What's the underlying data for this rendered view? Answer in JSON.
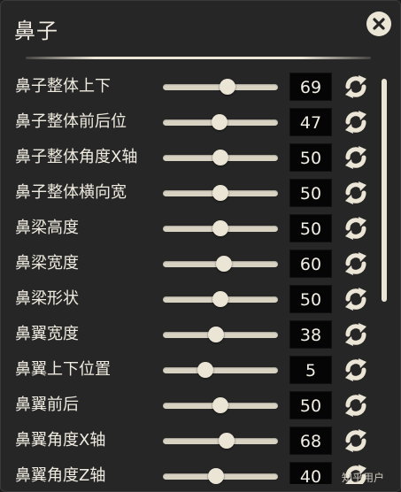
{
  "panel": {
    "title": "鼻子",
    "close_icon": "close-x-circle-icon"
  },
  "sliders": [
    {
      "label": "鼻子整体上下",
      "value": "69",
      "fraction": 0.56
    },
    {
      "label": "鼻子整体前后位",
      "value": "47",
      "fraction": 0.49
    },
    {
      "label": "鼻子整体角度X轴",
      "value": "50",
      "fraction": 0.5
    },
    {
      "label": "鼻子整体横向宽",
      "value": "50",
      "fraction": 0.5
    },
    {
      "label": "鼻梁高度",
      "value": "50",
      "fraction": 0.5
    },
    {
      "label": "鼻梁宽度",
      "value": "60",
      "fraction": 0.53
    },
    {
      "label": "鼻梁形状",
      "value": "50",
      "fraction": 0.5
    },
    {
      "label": "鼻翼宽度",
      "value": "38",
      "fraction": 0.46
    },
    {
      "label": "鼻翼上下位置",
      "value": "5",
      "fraction": 0.37
    },
    {
      "label": "鼻翼前后",
      "value": "50",
      "fraction": 0.5
    },
    {
      "label": "鼻翼角度X轴",
      "value": "68",
      "fraction": 0.55
    },
    {
      "label": "鼻翼角度Z轴",
      "value": "40",
      "fraction": 0.46
    }
  ],
  "reset_icon": "refresh-arrows-icon",
  "watermark": "知乎用户",
  "colors": {
    "panel_bg": "#262626",
    "text": "#f0ebe0",
    "accent": "#ebe5d6",
    "value_bg": "#050505"
  }
}
